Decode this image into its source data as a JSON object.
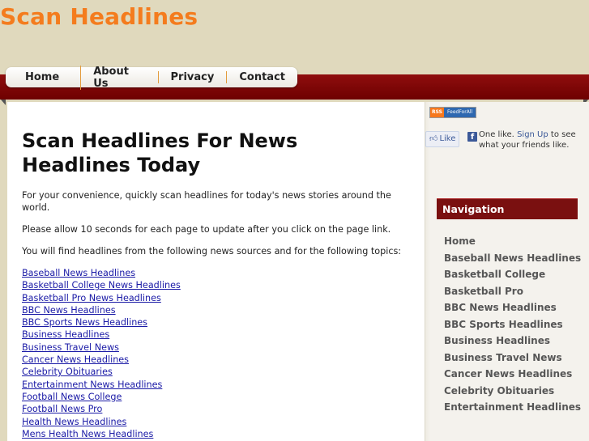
{
  "site": {
    "title": "Scan Headlines"
  },
  "nav_tabs": [
    "Home",
    "About Us",
    "Privacy",
    "Contact"
  ],
  "main": {
    "heading": "Scan Headlines For News Headlines Today",
    "para1": "For your convenience, quickly scan headlines for today's news stories around the world.",
    "para2": "Please allow 10 seconds for each page to update after you click on the page link.",
    "para3": "You will find headlines from the following news sources and for the following topics:",
    "links": [
      "Baseball News Headlines",
      "Basketball College News Headlines",
      "Basketball Pro News Headlines",
      "BBC News Headlines",
      "BBC Sports News Headlines",
      "Business Headlines",
      "Business Travel News",
      "Cancer News Headlines",
      "Celebrity Obituaries",
      "Entertainment News Headlines",
      "Football News College",
      "Football News Pro",
      "Health News Headlines",
      "Mens Health News Headlines"
    ]
  },
  "sidebar": {
    "rss_label": "RSS",
    "feed_label": "FeedForAll",
    "like_label": "Like",
    "fb_text_before": "One like.",
    "fb_signup": "Sign Up",
    "fb_text_after": "to see what your friends like.",
    "nav_title": "Navigation",
    "nav_items": [
      "Home",
      "Baseball News Headlines",
      "Basketball College",
      "Basketball Pro",
      "BBC News Headlines",
      "BBC Sports Headlines",
      "Business Headlines",
      "Business Travel News",
      "Cancer News Headlines",
      "Celebrity Obituaries",
      "Entertainment Headlines"
    ]
  },
  "colors": {
    "title": "#f47c1e",
    "bar": "#7a0505",
    "background": "#e0d9bd"
  }
}
